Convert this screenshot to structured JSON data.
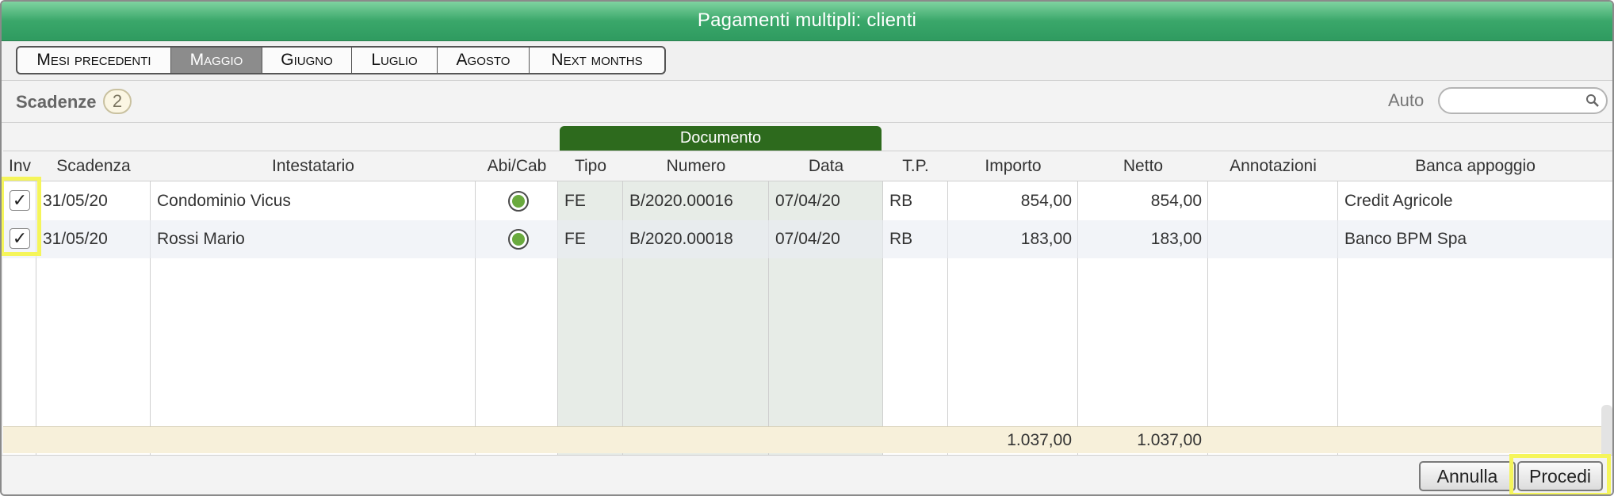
{
  "window": {
    "title": "Pagamenti multipli: clienti"
  },
  "months": {
    "tabs": [
      {
        "label": "Mesi precedenti",
        "active": false
      },
      {
        "label": "Maggio",
        "active": true
      },
      {
        "label": "Giugno",
        "active": false
      },
      {
        "label": "Luglio",
        "active": false
      },
      {
        "label": "Agosto",
        "active": false
      },
      {
        "label": "Next months",
        "active": false
      }
    ]
  },
  "scadenze": {
    "label": "Scadenze",
    "count": "2",
    "auto_label": "Auto",
    "search_value": ""
  },
  "grid": {
    "group_header": "Documento",
    "columns": [
      "Inv",
      "Scadenza",
      "Intestatario",
      "Abi/Cab",
      "Tipo",
      "Numero",
      "Data",
      "T.P.",
      "Importo",
      "Netto",
      "Annotazioni",
      "Banca appoggio"
    ],
    "rows": [
      {
        "inv": "✓",
        "scadenza": "31/05/20",
        "intestatario": "Condominio Vicus",
        "abicab_status": "green",
        "tipo": "FE",
        "numero": "B/2020.00016",
        "data": "07/04/20",
        "tp": "RB",
        "importo": "854,00",
        "netto": "854,00",
        "annotazioni": "",
        "banca": "Credit Agricole"
      },
      {
        "inv": "✓",
        "scadenza": "31/05/20",
        "intestatario": "Rossi Mario",
        "abicab_status": "green",
        "tipo": "FE",
        "numero": "B/2020.00018",
        "data": "07/04/20",
        "tp": "RB",
        "importo": "183,00",
        "netto": "183,00",
        "annotazioni": "",
        "banca": "Banco BPM Spa"
      }
    ],
    "totals": {
      "importo": "1.037,00",
      "netto": "1.037,00"
    }
  },
  "footer": {
    "cancel_label": "Annulla",
    "proceed_label": "Procedi"
  },
  "colors": {
    "title_green": "#3aa76a",
    "doc_header": "#2d6a1d",
    "highlight": "#f5f55a",
    "status_green": "#6aaa3e"
  }
}
